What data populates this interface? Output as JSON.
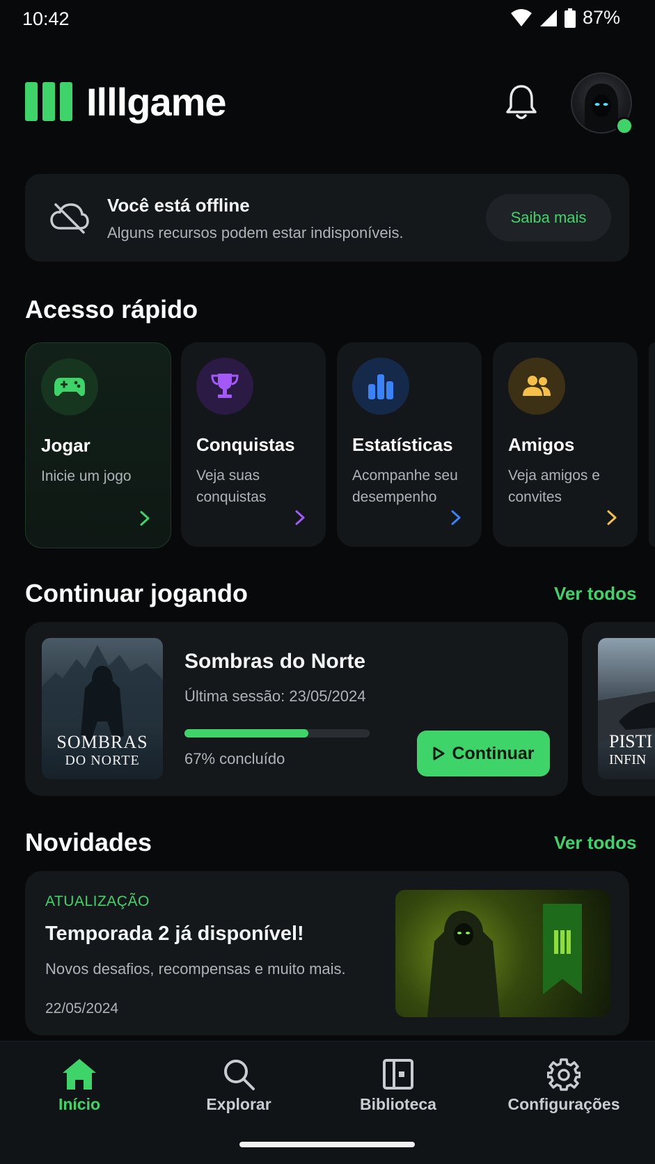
{
  "status_bar": {
    "time": "10:42",
    "battery": "87%"
  },
  "header": {
    "app_title": "Illlgame"
  },
  "offline": {
    "title": "Você está offline",
    "subtitle": "Alguns recursos podem estar indisponíveis.",
    "button": "Saiba mais"
  },
  "quick_access": {
    "heading": "Acesso rápido",
    "cards": [
      {
        "title": "Jogar",
        "desc": "Inicie um jogo",
        "icon": "gamepad-icon",
        "color": "#3fd46a"
      },
      {
        "title": "Conquistas",
        "desc": "Veja suas conquistas",
        "icon": "trophy-icon",
        "color": "#a259f7"
      },
      {
        "title": "Estatísticas",
        "desc": "Acompanhe seu desempenho",
        "icon": "bar-chart-icon",
        "color": "#3b82f6"
      },
      {
        "title": "Amigos",
        "desc": "Veja amigos e convites",
        "icon": "people-icon",
        "color": "#f5c04a"
      }
    ]
  },
  "continue_playing": {
    "heading": "Continuar jogando",
    "see_all": "Ver todos",
    "game": {
      "title": "Sombras do Norte",
      "cover_line1": "SOMBRAS",
      "cover_line2": "DO NORTE",
      "last_session": "Última sessão: 23/05/2024",
      "progress": 0.67,
      "progress_label": "67% concluído",
      "button": "Continuar"
    },
    "next_game": {
      "cover_line1": "PISTI",
      "cover_line2": "INFIN"
    }
  },
  "news": {
    "heading": "Novidades",
    "see_all": "Ver todos",
    "item": {
      "tag": "ATUALIZAÇÃO",
      "title": "Temporada 2 já disponível!",
      "subtitle": "Novos desafios, recompensas e muito mais.",
      "date": "22/05/2024"
    }
  },
  "bottom_nav": [
    {
      "label": "Início",
      "icon": "home-icon",
      "active": true
    },
    {
      "label": "Explorar",
      "icon": "search-icon",
      "active": false
    },
    {
      "label": "Biblioteca",
      "icon": "library-icon",
      "active": false
    },
    {
      "label": "Configurações",
      "icon": "gear-icon",
      "active": false
    }
  ],
  "colors": {
    "accent": "#3fd46a",
    "background": "#08090b",
    "card": "#15181b"
  }
}
